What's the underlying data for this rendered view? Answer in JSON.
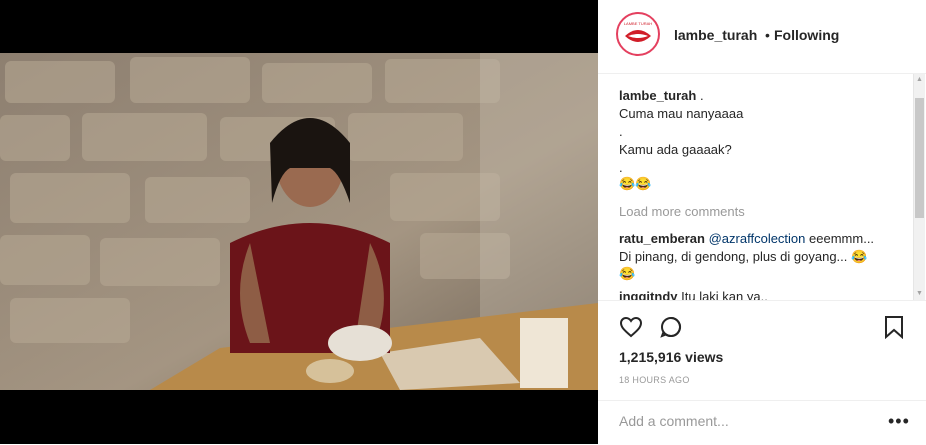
{
  "header": {
    "username": "lambe_turah",
    "separator": "•",
    "follow_status": "Following",
    "avatar_text": "LAMBE TURAH"
  },
  "caption": {
    "username": "lambe_turah",
    "text_1": ".",
    "line_1": "Cuma mau nanyaaaa",
    "line_2": ".",
    "line_3": "Kamu ada gaaaak?",
    "line_4": ".",
    "emoji": "😂😂"
  },
  "load_more": "Load more comments",
  "comments": [
    {
      "username": "ratu_emberan",
      "mention": "@azraffcolection",
      "text": "eeemmm...",
      "text_2": "Di pinang, di gendong, plus di goyang... 😂",
      "emoji": "😂"
    },
    {
      "username": "inggitndy",
      "text": "Itu laki kan ya.."
    }
  ],
  "stats": {
    "views": "1,215,916 views",
    "time": "18 HOURS AGO"
  },
  "add_comment": {
    "placeholder": "Add a comment...",
    "more": "•••"
  },
  "colors": {
    "brand_ring": "#e4405f",
    "link": "#003569",
    "muted": "#999999"
  }
}
